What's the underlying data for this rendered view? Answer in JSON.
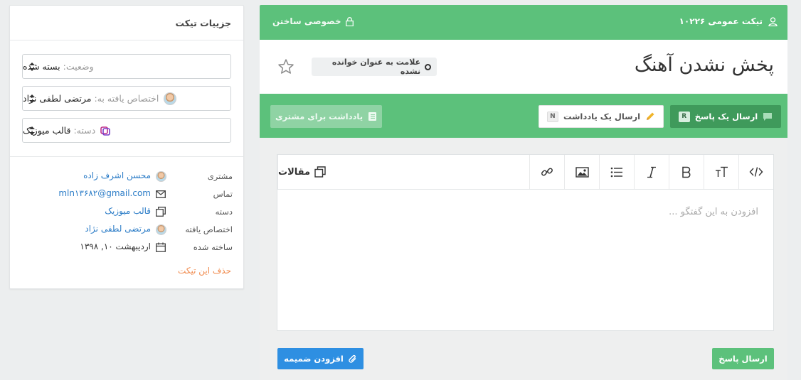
{
  "sidebar": {
    "title": "جزییات تیکت",
    "status": {
      "label": "وضعیت:",
      "value": "بسته شده"
    },
    "assignee": {
      "label": "اختصاص یافته به:",
      "value": "مرتضی لطفی نژاد"
    },
    "category": {
      "label": "دسته:",
      "value": "قالب میوزیک"
    },
    "info": {
      "customer": {
        "key": "مشتری",
        "value": "محسن اشرف زاده"
      },
      "contact": {
        "key": "تماس",
        "value": "mln۱۳۶۸۲@gmail.com"
      },
      "category": {
        "key": "دسته",
        "value": "قالب میوزیک"
      },
      "assigned": {
        "key": "اختصاص یافته",
        "value": "مرتضی لطفی نژاد"
      },
      "created": {
        "key": "ساخته شده",
        "value": "اردیبهشت ۱۰, ۱۳۹۸"
      }
    },
    "delete_link": "حذف این تیکت"
  },
  "topbar": {
    "ticket_label": "تیکت عمومی ۱۰۲۲۶",
    "private_label": "خصوصی ساختن"
  },
  "ticket": {
    "title": "پخش نشدن آهنگ",
    "mark_unread": "علامت به عنوان خوانده نشده"
  },
  "actions": {
    "reply": {
      "label": "ارسال یک پاسخ",
      "key": "R"
    },
    "note": {
      "label": "ارسال یک یادداشت",
      "key": "N"
    },
    "customer_note": "یادداشت برای مشتری"
  },
  "editor": {
    "articles_label": "مقالات",
    "placeholder": "افزودن به این گفتگو ..."
  },
  "footer": {
    "send_reply": "ارسال پاسخ",
    "add_attachment": "افزودن ضمیمه"
  },
  "colors": {
    "brand_green": "#5cc17b",
    "dark_green": "#3f9a5b",
    "link_blue": "#2b7cc7",
    "attach_blue": "#2e8fe2",
    "delete_orange": "#f0894b"
  },
  "icons": [
    "user-icon",
    "lock-icon",
    "star-icon",
    "comment-icon",
    "pencil-icon",
    "notebook-icon",
    "code-icon",
    "text-size-icon",
    "bold-icon",
    "italic-icon",
    "list-icon",
    "image-icon",
    "link-icon",
    "copy-icon",
    "paperclip-icon",
    "envelope-icon",
    "calendar-icon",
    "category-icon"
  ]
}
